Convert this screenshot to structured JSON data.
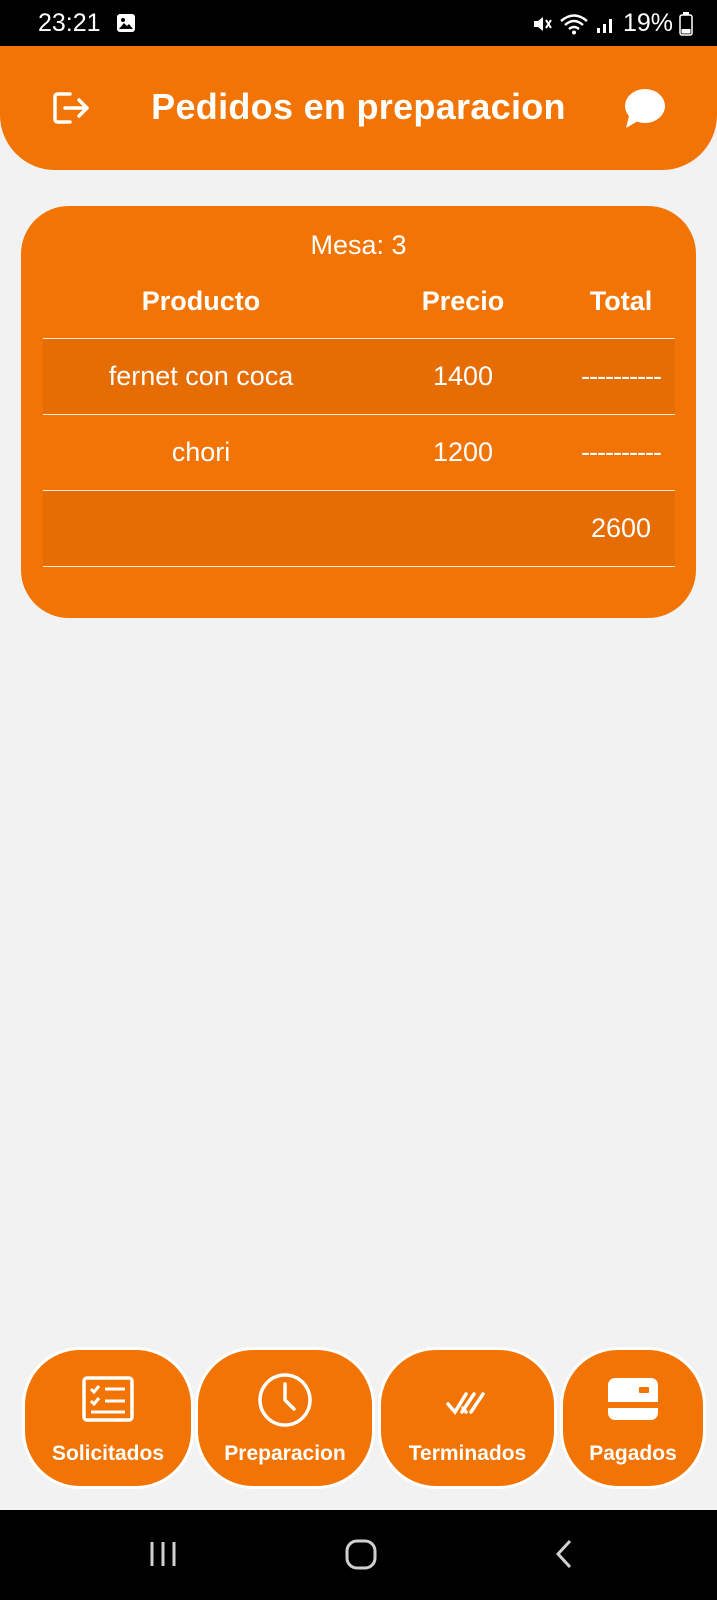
{
  "status_bar": {
    "time": "23:21",
    "battery": "19%",
    "icons": [
      "gallery-icon",
      "mute-icon",
      "wifi-icon",
      "signal-icon",
      "battery-icon"
    ]
  },
  "header": {
    "title": "Pedidos en preparacion",
    "left_icon": "logout-icon",
    "right_icon": "chat-icon"
  },
  "order": {
    "table_label": "Mesa: 3",
    "columns": [
      "Producto",
      "Precio",
      "Total"
    ],
    "rows": [
      {
        "product": "fernet con coca",
        "price": "1400",
        "total": "----------"
      },
      {
        "product": "chori",
        "price": "1200",
        "total": "----------"
      }
    ],
    "total_row": {
      "product": "",
      "price": "",
      "total": "2600"
    }
  },
  "bottom_nav": [
    {
      "label": "Solicitados",
      "icon": "checklist-icon"
    },
    {
      "label": "Preparacion",
      "icon": "clock-icon"
    },
    {
      "label": "Terminados",
      "icon": "double-check-icon"
    },
    {
      "label": "Pagados",
      "icon": "payment-card-icon"
    }
  ],
  "colors": {
    "accent": "#f27405",
    "accent_shaded": "#e66c04",
    "background": "#f2f2f2"
  },
  "system_nav": [
    "recent-apps-icon",
    "home-icon",
    "back-icon"
  ]
}
